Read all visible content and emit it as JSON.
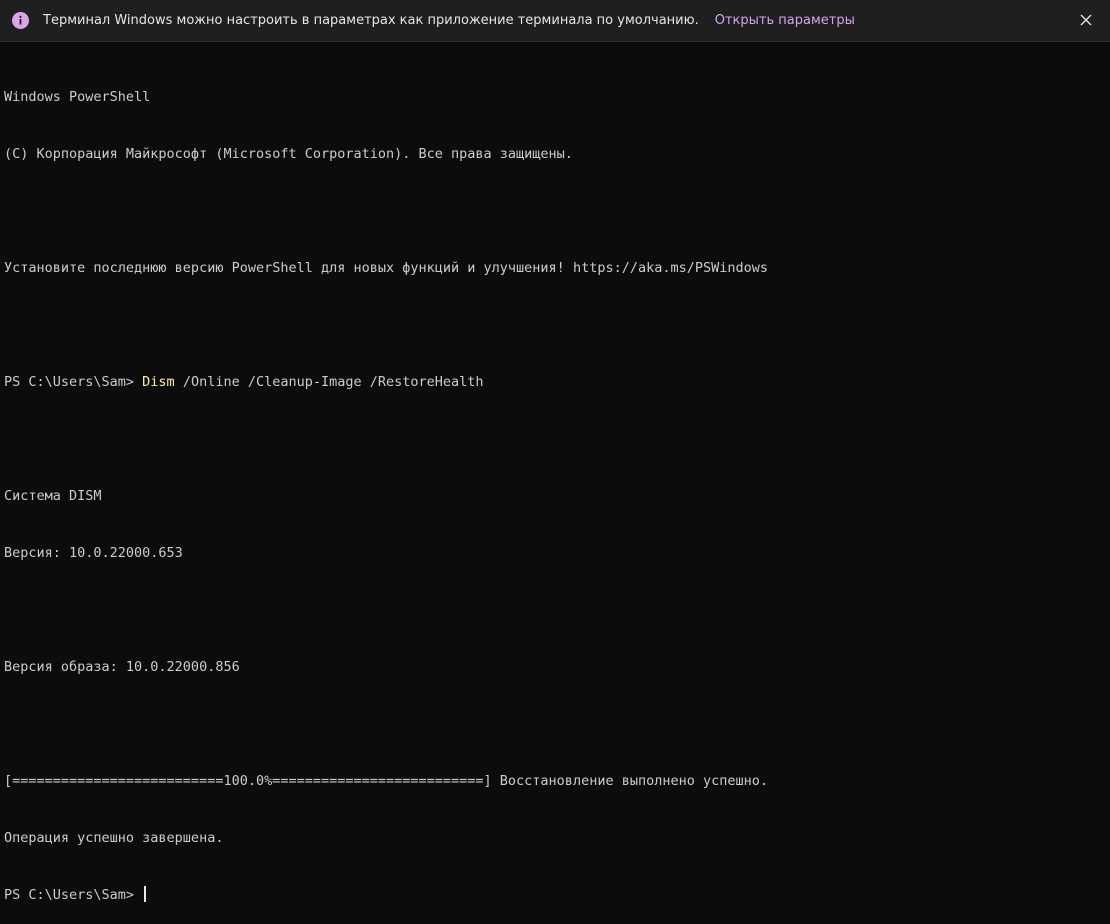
{
  "infobar": {
    "message": "Терминал Windows можно настроить в параметрах как приложение терминала по умолчанию.",
    "link": "Открыть параметры",
    "icon": "info-icon",
    "accent": "#d9a6e8"
  },
  "terminal": {
    "lines": [
      "Windows PowerShell",
      "(C) Корпорация Майкрософт (Microsoft Corporation). Все права защищены.",
      "",
      "Установите последнюю версию PowerShell для новых функций и улучшения! https://aka.ms/PSWindows",
      "",
      "",
      "",
      "Система DISM",
      "Версия: 10.0.22000.653",
      "",
      "Версия образа: 10.0.22000.856",
      "",
      "[==========================100.0%==========================] Восстановление выполнено успешно.",
      "Операция успешно завершена."
    ],
    "command_prompt": "PS C:\\Users\\Sam> ",
    "command_name": "Dism",
    "command_args": " /Online /Cleanup-Image /RestoreHealth",
    "final_prompt": "PS C:\\Users\\Sam> "
  }
}
